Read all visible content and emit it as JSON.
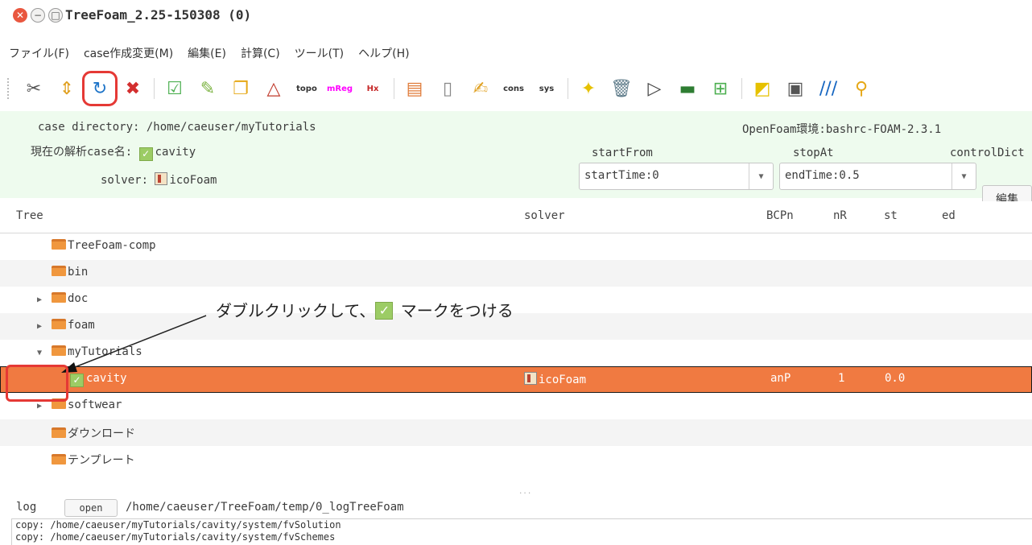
{
  "window": {
    "title": "TreeFoam_2.25-150308 (0)",
    "close_glyph": "✕",
    "min_glyph": "−",
    "max_glyph": "□"
  },
  "menu": [
    "ファイル(F)",
    "case作成変更(M)",
    "編集(E)",
    "計算(C)",
    "ツール(T)",
    "ヘルプ(H)"
  ],
  "toolbar": {
    "icons": [
      {
        "name": "tools-icon",
        "glyph": "✂",
        "color": "#555555"
      },
      {
        "name": "up-down-icon",
        "glyph": "⇕",
        "color": "#e0a020"
      },
      {
        "name": "refresh-icon",
        "glyph": "↻",
        "color": "#1e74c8",
        "highlight": true
      },
      {
        "name": "stop-icon",
        "glyph": "✖",
        "color": "#d32f2f"
      },
      {
        "name": "check-case-icon",
        "glyph": "☑",
        "color": "#4caf50"
      },
      {
        "name": "check-edit-icon",
        "glyph": "✎",
        "color": "#7cb342"
      },
      {
        "name": "copy-icon",
        "glyph": "❐",
        "color": "#e6a817"
      },
      {
        "name": "mesh-icon",
        "glyph": "△",
        "color": "#c0392b"
      },
      {
        "name": "topo-icon",
        "glyph": "topo",
        "color": "#333333",
        "small": true
      },
      {
        "name": "mreg-icon",
        "glyph": "mReg",
        "color": "#ff00ff",
        "small": true
      },
      {
        "name": "helyx-icon",
        "glyph": "Hx",
        "color": "#c62828",
        "small": true
      },
      {
        "name": "palette-icon",
        "glyph": "▤",
        "color": "#e07b39"
      },
      {
        "name": "document-icon",
        "glyph": "▯",
        "color": "#888888"
      },
      {
        "name": "edit-doc-icon",
        "glyph": "✍",
        "color": "#e0a020"
      },
      {
        "name": "cons-icon",
        "glyph": "cons",
        "color": "#333333",
        "small": true
      },
      {
        "name": "sys-icon",
        "glyph": "sys",
        "color": "#333333",
        "small": true
      },
      {
        "name": "star-doc-icon",
        "glyph": "✦",
        "color": "#e6c100"
      },
      {
        "name": "clear-icon",
        "glyph": "🗑",
        "color": "#607d8b"
      },
      {
        "name": "run-icon",
        "glyph": "▷",
        "color": "#444444"
      },
      {
        "name": "monitor-icon",
        "glyph": "▬",
        "color": "#2e7d32"
      },
      {
        "name": "grid-icon",
        "glyph": "⊞",
        "color": "#4caf50"
      },
      {
        "name": "paraview-doc-icon",
        "glyph": "◩",
        "color": "#e6c100"
      },
      {
        "name": "terminal-icon",
        "glyph": "▣",
        "color": "#555555"
      },
      {
        "name": "paraview-icon",
        "glyph": "///",
        "color": "#1565c0"
      },
      {
        "name": "more-icon",
        "glyph": "⚲",
        "color": "#e6a817"
      }
    ]
  },
  "case_info": {
    "directory_label": "case directory:",
    "directory_value": "/home/caeuser/myTutorials",
    "env_label": "OpenFoam環境:",
    "env_value": "bashrc-FOAM-2.3.1",
    "current_case_label": "現在の解析case名:",
    "current_case_value": "cavity",
    "solver_label": "solver:",
    "solver_value": "icoFoam",
    "start_from_label": "startFrom",
    "stop_at_label": "stopAt",
    "control_dict_label": "controlDict",
    "start_from_value": "startTime:0",
    "stop_at_value": "endTime:0.5",
    "edit_button": "編集"
  },
  "tree": {
    "columns": [
      "Tree",
      "solver",
      "BCPn",
      "nR",
      "st",
      "ed"
    ],
    "rows": [
      {
        "label": "TreeFoam-comp",
        "expander": ""
      },
      {
        "label": "bin",
        "expander": ""
      },
      {
        "label": "doc",
        "expander": "▶"
      },
      {
        "label": "foam",
        "expander": "▶"
      },
      {
        "label": "myTutorials",
        "expander": "▼"
      },
      {
        "label": "cavity",
        "solver": "icoFoam",
        "bcpn": "anP",
        "nr": "1",
        "st": "0.0",
        "selected": true
      },
      {
        "label": "softwear",
        "expander": "▶"
      },
      {
        "label": "ダウンロード",
        "expander": ""
      },
      {
        "label": "テンプレート",
        "expander": ""
      }
    ]
  },
  "annotation": {
    "text_before": "ダブルクリックして、",
    "text_after": " マークをつける"
  },
  "log": {
    "label": "log",
    "open_button": "open",
    "path": "/home/caeuser/TreeFoam/temp/0_logTreeFoam",
    "lines": [
      "copy: /home/caeuser/myTutorials/cavity/system/fvSolution",
      "copy: /home/caeuser/myTutorials/cavity/system/fvSchemes"
    ],
    "splitter": "..."
  },
  "colors": {
    "selected_row": "#f07a41",
    "info_bg": "#eefbee",
    "highlight_red": "#e53935"
  }
}
